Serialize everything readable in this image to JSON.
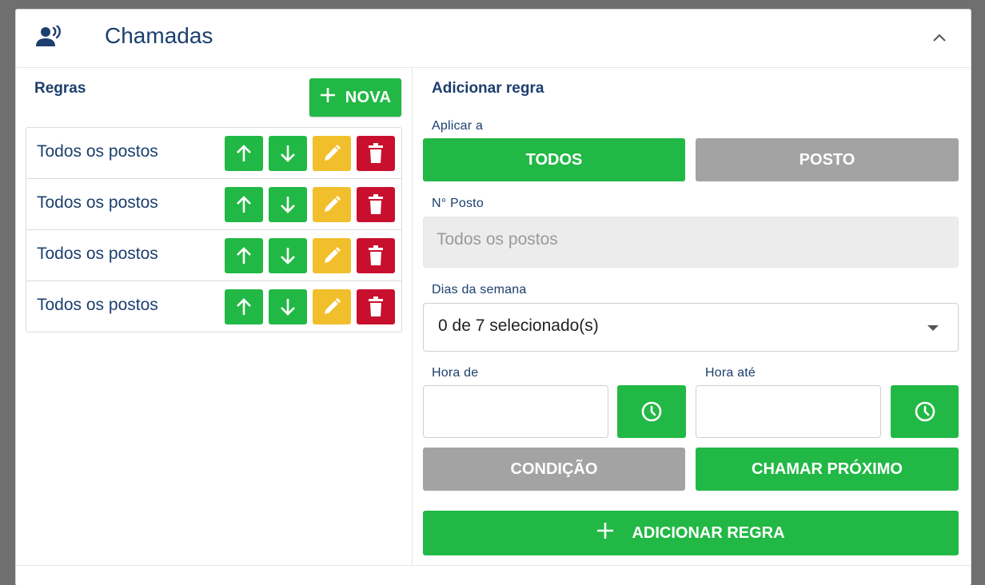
{
  "header": {
    "title": "Chamadas",
    "icon": "person-voice-icon",
    "collapse_icon": "chevron-up-icon"
  },
  "rules_panel": {
    "title": "Regras",
    "new_button": {
      "label": "NOVA",
      "icon": "plus-icon"
    },
    "items": [
      {
        "label": "Todos os postos"
      },
      {
        "label": "Todos os postos"
      },
      {
        "label": "Todos os postos"
      },
      {
        "label": "Todos os postos"
      }
    ],
    "item_actions": [
      "arrow-up-icon",
      "arrow-down-icon",
      "pencil-icon",
      "trash-icon"
    ]
  },
  "form": {
    "title": "Adicionar regra",
    "apply_label": "Aplicar a",
    "apply_options": [
      {
        "label": "TODOS",
        "selected": true
      },
      {
        "label": "POSTO",
        "selected": false
      }
    ],
    "posto_label": "N° Posto",
    "posto_placeholder": "Todos os postos",
    "weekdays_label": "Dias da semana",
    "weekdays_value": "0 de 7 selecionado(s)",
    "hour_from_label": "Hora de",
    "hour_to_label": "Hora até",
    "hour_from_value": "",
    "hour_to_value": "",
    "condition_button": "CONDIÇÃO",
    "call_next_button": "CHAMAR PRÓXIMO",
    "add_button": "ADICIONAR REGRA"
  },
  "colors": {
    "green": "#22b845",
    "yellow": "#f1bf2c",
    "red": "#c8102e",
    "grey": "#a3a3a3",
    "navy": "#1c3f6e"
  }
}
